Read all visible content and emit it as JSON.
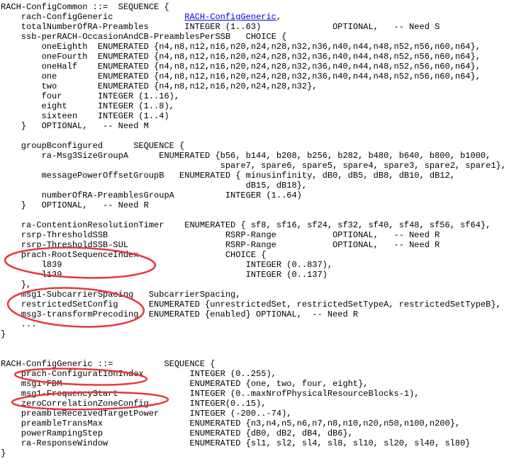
{
  "annotation_color": "#e8383d",
  "link_color": "#0000ee",
  "lines": [
    {
      "text": "RACH-ConfigCommon ::=  SEQUENCE {"
    },
    {
      "text": "    rach-ConfigGeneric              ",
      "link": "RACH-ConfigGeneric",
      "after": ","
    },
    {
      "text": "    totalNumberOfRA-Preambles       INTEGER (1..63)              OPTIONAL,   -- Need S"
    },
    {
      "text": "    ssb-perRACH-OccasionAndCB-PreamblesPerSSB   CHOICE {"
    },
    {
      "text": "        oneEighth  ENUMERATED {n4,n8,n12,n16,n20,n24,n28,n32,n36,n40,n44,n48,n52,n56,n60,n64},"
    },
    {
      "text": "        oneFourth  ENUMERATED {n4,n8,n12,n16,n20,n24,n28,n32,n36,n40,n44,n48,n52,n56,n60,n64},"
    },
    {
      "text": "        oneHalf    ENUMERATED {n4,n8,n12,n16,n20,n24,n28,n32,n36,n40,n44,n48,n52,n56,n60,n64},"
    },
    {
      "text": "        one        ENUMERATED {n4,n8,n12,n16,n20,n24,n28,n32,n36,n40,n44,n48,n52,n56,n60,n64},"
    },
    {
      "text": "        two        ENUMERATED {n4,n8,n12,n16,n20,n24,n28,n32},"
    },
    {
      "text": "        four       INTEGER (1..16),"
    },
    {
      "text": "        eight      INTEGER (1..8),"
    },
    {
      "text": "        sixteen    INTEGER (1..4)"
    },
    {
      "text": "    }   OPTIONAL,   -- Need M"
    },
    {
      "text": ""
    },
    {
      "text": "    groupBconfigured      SEQUENCE {"
    },
    {
      "text": "        ra-Msg3SizeGroupA      ENUMERATED {b56, b144, b208, b256, b282, b480, b640, b800, b1000,"
    },
    {
      "text": "                                           spare7, spare6, spare5, spare4, spare3, spare2, spare1},"
    },
    {
      "text": "        messagePowerOffsetGroupB   ENUMERATED { minusinfinity, dB0, dB5, dB8, dB10, dB12,"
    },
    {
      "text": "                                                dB15, dB18},"
    },
    {
      "text": "        numberOfRA-PreamblesGroupA          INTEGER (1..64)"
    },
    {
      "text": "    }   OPTIONAL,   -- Need R"
    },
    {
      "text": ""
    },
    {
      "text": "    ra-ContentionResolutionTimer    ENUMERATED { sf8, sf16, sf24, sf32, sf40, sf48, sf56, sf64},"
    },
    {
      "text": "    rsrp-ThresholdSSB                       RSRP-Range           OPTIONAL,   -- Need R"
    },
    {
      "text": "    rsrp-ThresholdSSB-SUL                   RSRP-Range           OPTIONAL,   -- Need R"
    },
    {
      "text": "    prach-RootSequenceIndex                 CHOICE {"
    },
    {
      "text": "        l839                                    INTEGER (0..837),"
    },
    {
      "text": "        l139                                    INTEGER (0..137)"
    },
    {
      "text": "    },"
    },
    {
      "text": "    msg1-SubcarrierSpacing   SubcarrierSpacing,"
    },
    {
      "text": "    restrictedSetConfig      ENUMERATED {unrestrictedSet, restrictedSetTypeA, restrictedSetTypeB},"
    },
    {
      "text": "    msg3-transformPrecoding  ENUMERATED {enabled} OPTIONAL,  -- Need R"
    },
    {
      "text": "    ..."
    },
    {
      "text": "}"
    },
    {
      "text": ""
    },
    {
      "text": ""
    },
    {
      "text": "RACH-ConfigGeneric ::=          SEQUENCE {"
    },
    {
      "text": "    prach-ConfigurationIndex         INTEGER (0..255),"
    },
    {
      "text": "    msg1-FDM                         ENUMERATED {one, two, four, eight},"
    },
    {
      "text": "    msg1-FrequencyStart              INTEGER (0..maxNrofPhysicalResourceBlocks-1),"
    },
    {
      "text": "    zeroCorrelationZoneConfig        INTEGER(0..15),"
    },
    {
      "text": "    preambleReceivedTargetPower      INTEGER (-200..-74),"
    },
    {
      "text": "    preambleTransMax                 ENUMERATED {n3,n4,n5,n6,n7,n8,n10,n20,n50,n100,n200},"
    },
    {
      "text": "    powerRampingStep                 ENUMERATED {dB0, dB2, dB4, dB6},"
    },
    {
      "text": "    ra-ResponseWindow                ENUMERATED {sl1, sl2, sl4, sl8, sl10, sl20, sl40, sl80}"
    },
    {
      "text": "}"
    }
  ]
}
